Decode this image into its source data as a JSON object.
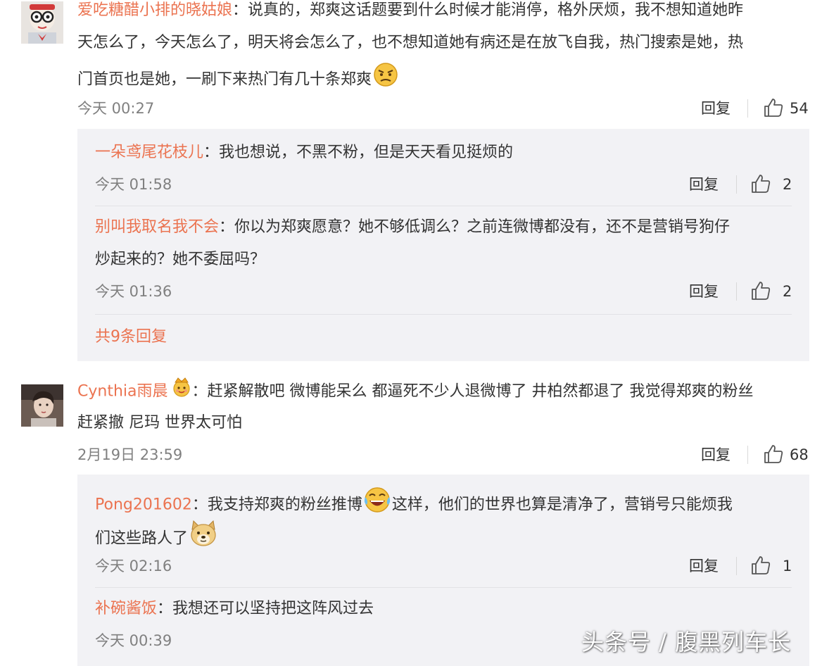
{
  "comments": [
    {
      "user": "爱吃糖醋小排的晓姑娘",
      "sep": "：",
      "line1": "说真的，郑爽这话题要到什么时候才能消停，格外厌烦，我不想知道她昨",
      "line2": "天怎么了，今天怎么了，明天将会怎么了，也不想知道她有病还是在放飞自我，热门搜索是她，热",
      "line3": "门首页也是她，一刷下来热门有几十条郑爽",
      "emoji": "angry-face-emoji",
      "time": "今天 00:27",
      "reply_label": "回复",
      "likes": "54",
      "replies": [
        {
          "user": "一朵鸢尾花枝儿",
          "sep": "：",
          "line1": "我也想说，不黑不粉，但是天天看见挺烦的",
          "time": "今天 01:58",
          "reply_label": "回复",
          "likes": "2"
        },
        {
          "user": "别叫我取名我不会",
          "sep": "：",
          "line1": "你以为郑爽愿意？她不够低调么？之前连微博都没有，还不是营销号狗仔",
          "line2": "炒起来的？她不委屈吗？",
          "time": "今天 01:36",
          "reply_label": "回复",
          "likes": "2"
        }
      ],
      "more_replies": "共9条回复"
    },
    {
      "user": "Cynthia雨晨",
      "badge": "crown-face-badge",
      "sep": "：",
      "line1": "赶紧解散吧 微博能呆么 都逼死不少人退微博了 井柏然都退了 我觉得郑爽的粉丝",
      "line2": "赶紧撤 尼玛 世界太可怕",
      "time": "2月19日 23:59",
      "reply_label": "回复",
      "likes": "68",
      "replies": [
        {
          "user": "Pong201602",
          "sep": "：",
          "line1a": "我支持郑爽的粉丝推博",
          "emoji1": "laugh-cry-emoji",
          "line1b": "这样，他们的世界也算是清净了，营销号只能烦我",
          "line2": "们这些路人了",
          "emoji2": "doge-emoji",
          "time": "今天 02:16",
          "reply_label": "回复",
          "likes": "1"
        },
        {
          "user": "补碗酱饭",
          "sep": "：",
          "line1": "我想还可以坚持把这阵风过去",
          "time": "今天 00:39"
        }
      ]
    }
  ],
  "watermark": "头条号 / 腹黑列车长",
  "colors": {
    "username": "#eb7350",
    "meta": "#808080",
    "panel": "#f2f2f5"
  }
}
